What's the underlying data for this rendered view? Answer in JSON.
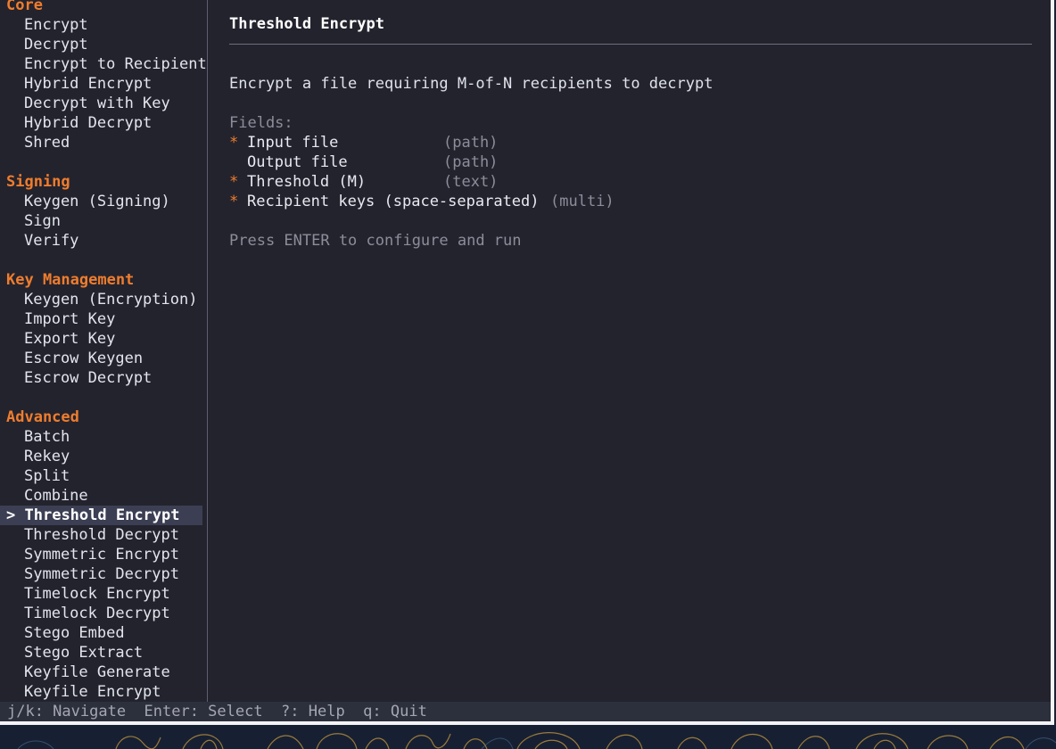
{
  "sidebar": {
    "sections": [
      {
        "title": "Core",
        "items": [
          "Encrypt",
          "Decrypt",
          "Encrypt to Recipient",
          "Hybrid Encrypt",
          "Decrypt with Key",
          "Hybrid Decrypt",
          "Shred"
        ]
      },
      {
        "title": "Signing",
        "items": [
          "Keygen (Signing)",
          "Sign",
          "Verify"
        ]
      },
      {
        "title": "Key Management",
        "items": [
          "Keygen (Encryption)",
          "Import Key",
          "Export Key",
          "Escrow Keygen",
          "Escrow Decrypt"
        ]
      },
      {
        "title": "Advanced",
        "items": [
          "Batch",
          "Rekey",
          "Split",
          "Combine",
          "Threshold Encrypt",
          "Threshold Decrypt",
          "Symmetric Encrypt",
          "Symmetric Decrypt",
          "Timelock Encrypt",
          "Timelock Decrypt",
          "Stego Embed",
          "Stego Extract",
          "Keyfile Generate",
          "Keyfile Encrypt"
        ]
      }
    ],
    "selected_marker": ">",
    "selected_label": "Threshold Encrypt"
  },
  "detail": {
    "title": "Threshold Encrypt",
    "description": "Encrypt a file requiring M-of-N recipients to decrypt",
    "fields_heading": "Fields:",
    "required_marker": "*",
    "fields": [
      {
        "name": "Input file",
        "type": "(path)",
        "required": true
      },
      {
        "name": "Output file",
        "type": "(path)",
        "required": false
      },
      {
        "name": "Threshold (M)",
        "type": "(text)",
        "required": true
      },
      {
        "name": "Recipient keys (space-separated)",
        "type": "(multi)",
        "required": true
      }
    ],
    "hint": "Press ENTER to configure and run"
  },
  "statusbar": {
    "text": "j/k: Navigate  Enter: Select  ?: Help  q: Quit"
  },
  "colors": {
    "accent": "#ef7d2d",
    "background": "#23232e",
    "selection": "#3c3f53"
  }
}
